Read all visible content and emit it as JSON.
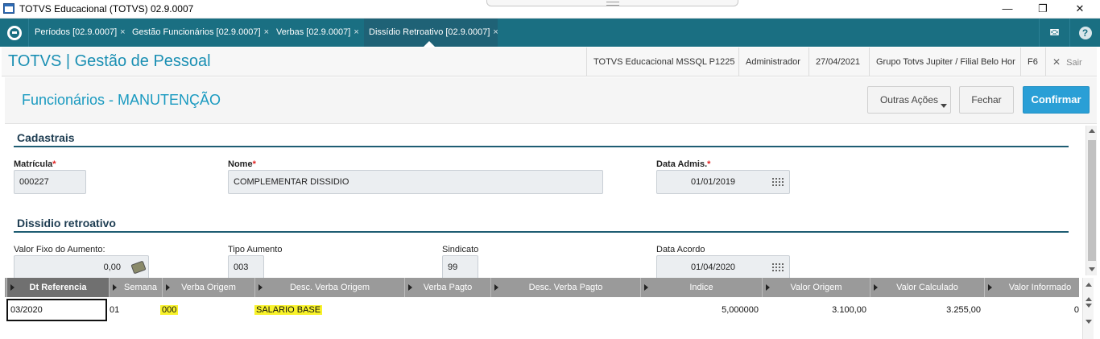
{
  "window": {
    "title": "TOTVS Educacional (TOTVS) 02.9.0007",
    "controls": {
      "minimize": "—",
      "maximize": "❐",
      "close": "✕"
    }
  },
  "tabs": [
    {
      "label": "Períodos [02.9.0007]",
      "close": "×"
    },
    {
      "label": "Gestão Funcionários [02.9.0007]",
      "close": "×"
    },
    {
      "label": "Verbas [02.9.0007]",
      "close": "×"
    },
    {
      "label": "Dissídio Retroativo [02.9.0007]",
      "close": "×"
    }
  ],
  "tabbar_icons": {
    "mail": "mail-icon",
    "help": "?"
  },
  "header": {
    "brand": "TOTVS | Gestão de Pessoal",
    "items": [
      "TOTVS Educacional MSSQL P1225",
      "Administrador",
      "27/04/2021",
      "Grupo Totvs Jupiter / Filial Belo Hor",
      "F6"
    ],
    "sair": "Sair",
    "sair_icon": "✕"
  },
  "page": {
    "title": "Funcionários - MANUTENÇÃO",
    "buttons": {
      "outras_acoes": "Outras Ações",
      "fechar": "Fechar",
      "confirmar": "Confirmar"
    }
  },
  "cadastrais": {
    "section_title": "Cadastrais",
    "matricula_label": "Matrícula",
    "matricula_value": "000227",
    "nome_label": "Nome",
    "nome_value": "COMPLEMENTAR DISSIDIO",
    "data_admis_label": "Data Admis.",
    "data_admis_value": "01/01/2019",
    "required_mark": "*"
  },
  "dissidio": {
    "section_title": "Dissidio retroativo",
    "valor_fixo_label": "Valor Fixo do Aumento:",
    "valor_fixo_value": "0,00",
    "tipo_aumento_label": "Tipo Aumento",
    "tipo_aumento_value": "003",
    "sindicato_label": "Sindicato",
    "sindicato_value": "99",
    "data_acordo_label": "Data Acordo",
    "data_acordo_value": "01/04/2020"
  },
  "grid": {
    "columns": [
      "Dt Referencia",
      "Semana",
      "Verba Origem",
      "Desc. Verba Origem",
      "Verba Pagto",
      "Desc. Verba Pagto",
      "Indice",
      "Valor Origem",
      "Valor Calculado",
      "Valor Informado"
    ],
    "rows": [
      {
        "dt_referencia": "03/2020",
        "semana": "01",
        "verba_origem": "000",
        "desc_verba_origem": "SALARIO BASE",
        "verba_pagto": "",
        "desc_verba_pagto": "",
        "indice": "5,000000",
        "valor_origem": "3.100,00",
        "valor_calculado": "3.255,00",
        "valor_informado": "0"
      }
    ],
    "highlight_color": "#f8f22a"
  },
  "colors": {
    "tabbar": "#1a6f82",
    "brand": "#1a8fb3",
    "primary_button": "#2a9fd6",
    "section_line": "#1e5d73"
  }
}
